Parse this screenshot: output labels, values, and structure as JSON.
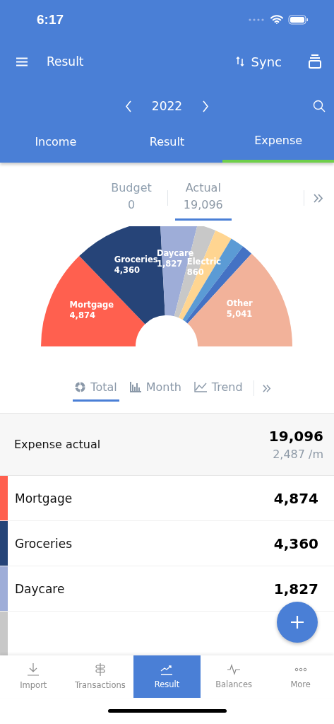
{
  "status_bar": {
    "time": "6:17"
  },
  "header": {
    "title": "Result",
    "sync_label": "Sync"
  },
  "year_nav": {
    "year": "2022"
  },
  "tabs": [
    {
      "label": "Income",
      "selected": false
    },
    {
      "label": "Result",
      "selected": false
    },
    {
      "label": "Expense",
      "selected": true
    }
  ],
  "figures": [
    {
      "label": "Budget",
      "value": "0",
      "selected": false
    },
    {
      "label": "Actual",
      "value": "19,096",
      "selected": true
    }
  ],
  "chart": {
    "chart_data": {
      "type": "donut",
      "categories": [
        "Mortgage",
        "Groceries",
        "Daycare",
        null,
        "Electric",
        null,
        null,
        "Other"
      ],
      "values": [
        4874,
        4360,
        1827,
        914,
        860,
        680,
        540,
        5041
      ],
      "colors": [
        "#ff604f",
        "#264478",
        "#9eadd8",
        "#c8c8c8",
        "#ffd591",
        "#5b9bd5",
        "#4472c4",
        "#f2b29a"
      ],
      "value_labels": [
        "4,874",
        "4,360",
        "1,827",
        null,
        "860",
        null,
        null,
        "5,041"
      ]
    }
  },
  "view_tabs": [
    {
      "label": "Total",
      "selected": true
    },
    {
      "label": "Month",
      "selected": false
    },
    {
      "label": "Trend",
      "selected": false
    }
  ],
  "summary": {
    "label": "Expense actual",
    "total": "19,096",
    "per_month": "2,487 /m"
  },
  "rows": [
    {
      "label": "Mortgage",
      "value": "4,874",
      "color": "#ff604f"
    },
    {
      "label": "Groceries",
      "value": "4,360",
      "color": "#264478"
    },
    {
      "label": "Daycare",
      "value": "1,827",
      "color": "#9eadd8"
    }
  ],
  "partial_row": {
    "color": "#c8c8c8"
  },
  "bottom_nav": [
    {
      "label": "Import",
      "selected": false
    },
    {
      "label": "Transactions",
      "selected": false
    },
    {
      "label": "Result",
      "selected": true
    },
    {
      "label": "Balances",
      "selected": false
    },
    {
      "label": "More",
      "selected": false
    }
  ]
}
